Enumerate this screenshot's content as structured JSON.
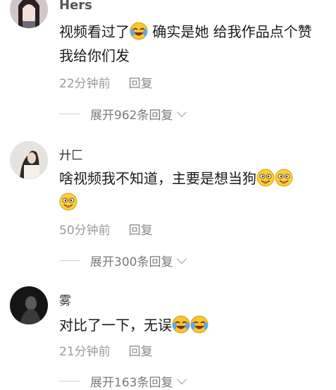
{
  "comments": [
    {
      "username": "Hers",
      "text_a": "视频看过了",
      "text_b": "确实是她 给我作品点个赞 我给你们发",
      "time": "22分钟前",
      "reply": "回复",
      "expand": "展开962条回复"
    },
    {
      "username": "廾匚",
      "text_a": "啥视频我不知道，主要是想当狗",
      "text_b": "",
      "time": "50分钟前",
      "reply": "回复",
      "expand": "展开300条回复"
    },
    {
      "username": "雾",
      "text_a": "对比了一下，无误",
      "text_b": "",
      "time": "21分钟前",
      "reply": "回复",
      "expand": "展开163条回复"
    }
  ],
  "icons": {
    "emoji_laugh_cry": "laugh-cry-emoji-icon",
    "emoji_silly": "silly-face-emoji-icon",
    "chevron": "chevron-down-icon"
  }
}
